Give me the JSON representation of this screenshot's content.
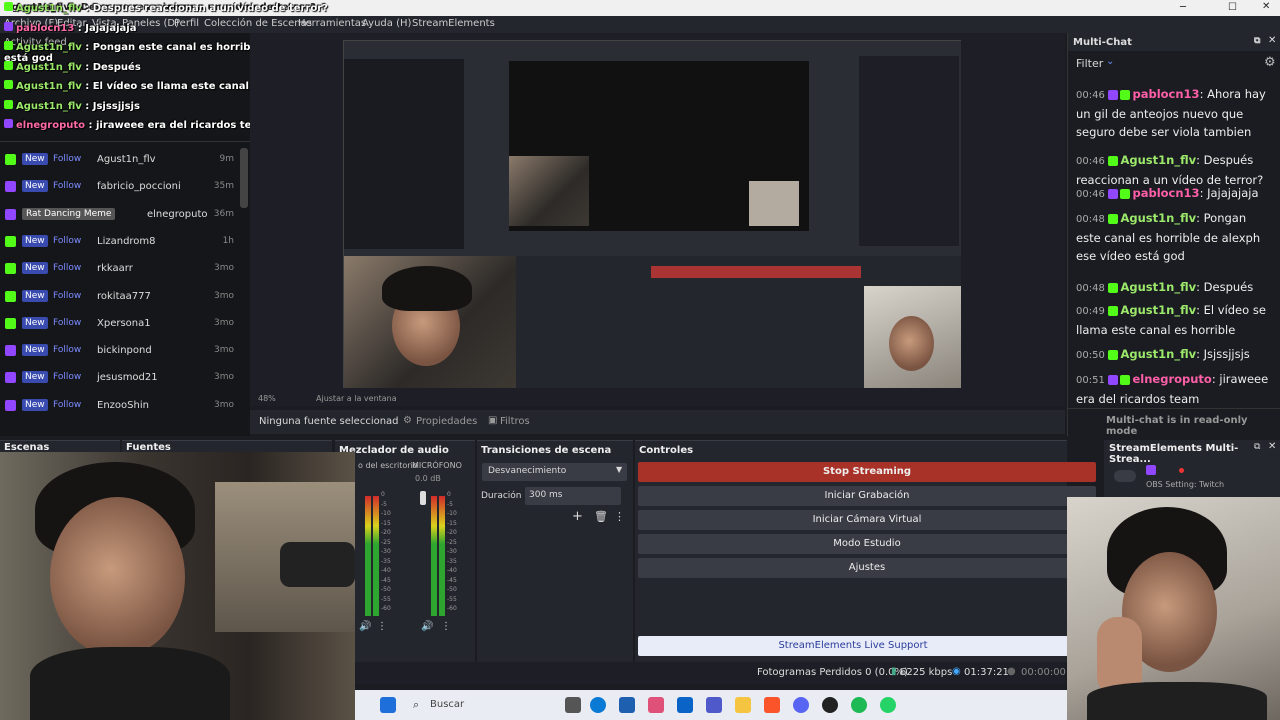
{
  "window": {
    "title": "Agust1n_flv : Despues reaccionan a un vídeo de terror?"
  },
  "menu": {
    "items": [
      "Archivo (F)",
      "Editar",
      "Vista",
      "Paneles (D)",
      "Perfil",
      "Colección de Escenas",
      "Herramientas",
      "Ayuda (H)",
      "StreamElements"
    ]
  },
  "overlay_chat": [
    {
      "user": "Agust1n_flv",
      "text": " : Despues reaccionan a un vídeo de terror?"
    },
    {
      "user": "pablocn13",
      "text": " : Jajajajaja"
    },
    {
      "user": "Agust1n_flv",
      "text": " : Pongan este canal es horrible de alexph ese vídeo está god"
    },
    {
      "user": "Agust1n_flv",
      "text": " : Después"
    },
    {
      "user": "Agust1n_flv",
      "text": " : El vídeo se llama este canal es horrible"
    },
    {
      "user": "Agust1n_flv",
      "text": " : Jsjssjjsjs"
    },
    {
      "user": "elnegroputo",
      "text": " : jiraweee era del ricardos team"
    }
  ],
  "activity_feed": {
    "title": "Activity feed",
    "rows": [
      {
        "platform": "kick",
        "badge": "New",
        "action": "Follow",
        "name": "Agust1n_flv",
        "time": "9m"
      },
      {
        "platform": "twitch",
        "badge": "New",
        "action": "Follow",
        "name": "fabricio_poccioni",
        "time": "35m"
      },
      {
        "platform": "twitch",
        "badge": "Rat Dancing Meme",
        "action": "",
        "name": "elnegroputo",
        "time": "36m"
      },
      {
        "platform": "kick",
        "badge": "New",
        "action": "Follow",
        "name": "Lizandrom8",
        "time": "1h"
      },
      {
        "platform": "kick",
        "badge": "New",
        "action": "Follow",
        "name": "rkkaarr",
        "time": "3mo"
      },
      {
        "platform": "kick",
        "badge": "New",
        "action": "Follow",
        "name": "rokitaa777",
        "time": "3mo"
      },
      {
        "platform": "kick",
        "badge": "New",
        "action": "Follow",
        "name": "Xpersona1",
        "time": "3mo"
      },
      {
        "platform": "twitch",
        "badge": "New",
        "action": "Follow",
        "name": "bickinpond",
        "time": "3mo"
      },
      {
        "platform": "twitch",
        "badge": "New",
        "action": "Follow",
        "name": "jesusmod21",
        "time": "3mo"
      },
      {
        "platform": "twitch",
        "badge": "New",
        "action": "Follow",
        "name": "EnzooShin",
        "time": "3mo"
      }
    ]
  },
  "preview": {
    "zoom": "48%",
    "fit_label": "Ajustar a la ventana",
    "no_source": "Ninguna fuente seleccionad",
    "properties": "Propiedades",
    "filters": "Filtros"
  },
  "multichat": {
    "title": "Multi-Chat",
    "filter": "Filter",
    "footer": "Multi-chat is in read-only mode",
    "messages": [
      {
        "time": "00:46",
        "user": "pablocn13",
        "color": "pink",
        "text": "Ahora hay un gil de anteojos nuevo que seguro debe ser viola tambien"
      },
      {
        "time": "00:46",
        "user": "Agust1n_flv",
        "color": "green",
        "text": "Después reaccionan a un vídeo de terror?"
      },
      {
        "time": "00:46",
        "user": "pablocn13",
        "color": "pink",
        "text": "Jajajajaja"
      },
      {
        "time": "00:48",
        "user": "Agust1n_flv",
        "color": "green",
        "text": "Pongan este canal es horrible de alexph ese vídeo está god"
      },
      {
        "time": "00:48",
        "user": "Agust1n_flv",
        "color": "green",
        "text": "Después"
      },
      {
        "time": "00:49",
        "user": "Agust1n_flv",
        "color": "green",
        "text": "El vídeo se llama este canal es horrible"
      },
      {
        "time": "00:50",
        "user": "Agust1n_flv",
        "color": "green",
        "text": "Jsjssjjsjs"
      },
      {
        "time": "00:51",
        "user": "elnegroputo",
        "color": "pink",
        "text": "jiraweee era del ricardos team"
      }
    ]
  },
  "docks": {
    "scenes": "Escenas",
    "sources": "Fuentes",
    "mixer": "Mezclador de audio",
    "transitions": "Transiciones de escena",
    "controls": "Controles",
    "se_multistream": "StreamElements Multi-Strea..."
  },
  "mixer": {
    "channel1": "o del escritorio",
    "channel2": "MICRÓFONO",
    "db": "0.0 dB",
    "scale": [
      "0",
      "-5",
      "-10",
      "-15",
      "-20",
      "-25",
      "-30",
      "-35",
      "-40",
      "-45",
      "-50",
      "-55",
      "-60"
    ]
  },
  "transitions": {
    "type": "Desvanecimiento",
    "duration_label": "Duración",
    "duration_value": "300 ms"
  },
  "controls": {
    "stop_streaming": "Stop Streaming",
    "start_recording": "Iniciar Grabación",
    "virtual_cam": "Iniciar Cámara Virtual",
    "studio_mode": "Modo Estudio",
    "settings": "Ajustes",
    "support": "StreamElements Live Support"
  },
  "se_panel": {
    "setting": "OBS Setting: Twitch"
  },
  "status": {
    "dropped": "Fotogramas Perdidos 0 (0.0%)",
    "bitrate": "6225 kbps",
    "live_time": "01:37:21",
    "rec_time": "00:00:00"
  },
  "taskbar": {
    "search": "Buscar"
  },
  "colors": {
    "stop_red": "#c0392b",
    "kick_green": "#53fc18",
    "twitch_purple": "#9146ff",
    "accent_blue": "#3a4bb0"
  }
}
